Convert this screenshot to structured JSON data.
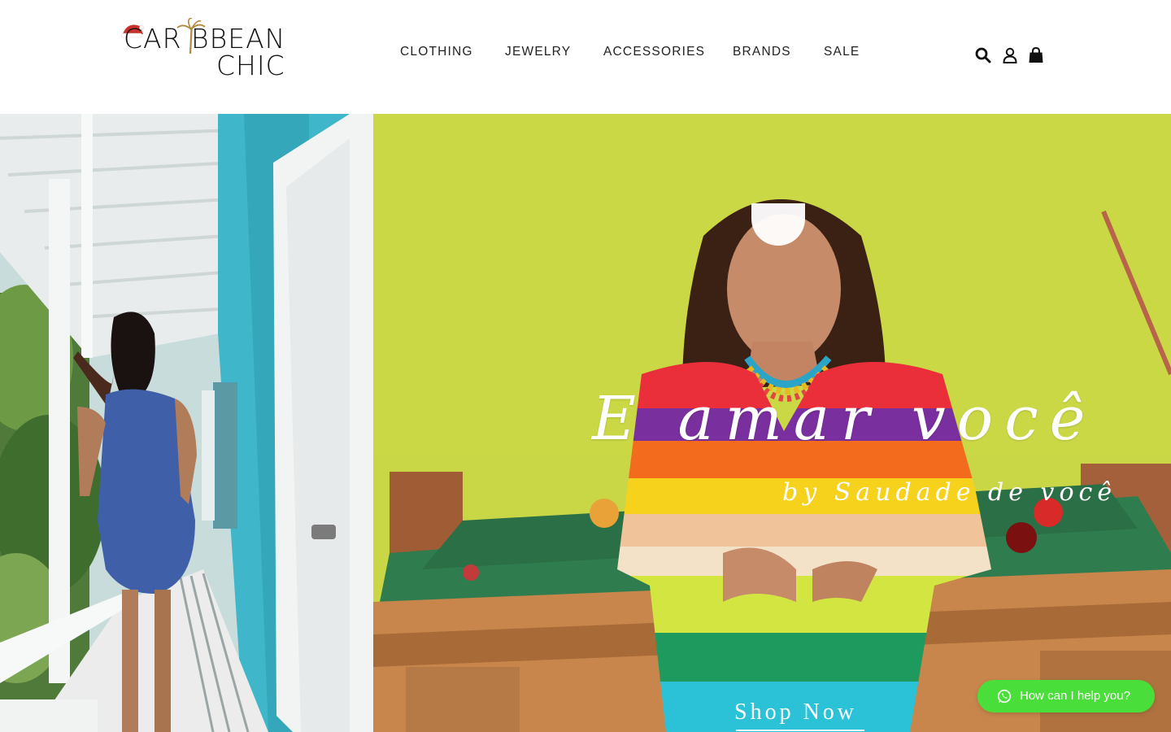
{
  "header": {
    "logo": {
      "line1": "CAR BBEAN",
      "line2": "CHIC",
      "alt": "Caribbean Chic"
    },
    "nav": [
      {
        "label": "CLOTHING"
      },
      {
        "label": "JEWELRY"
      },
      {
        "label": "ACCESSORIES"
      },
      {
        "label": "BRANDS"
      },
      {
        "label": "SALE"
      }
    ],
    "icons": [
      "search-icon",
      "account-icon",
      "cart-icon"
    ]
  },
  "hero": {
    "title": "E amar você",
    "subtitle": "by Saudade de você",
    "cta": "Shop Now"
  },
  "chat": {
    "label": "How can I help you?",
    "icon": "whatsapp-icon",
    "color": "#4ade3a"
  },
  "colors": {
    "accent_green": "#4ade3a",
    "hero_wall": "#c9d646",
    "veranda_blue": "#3fb6c9"
  }
}
